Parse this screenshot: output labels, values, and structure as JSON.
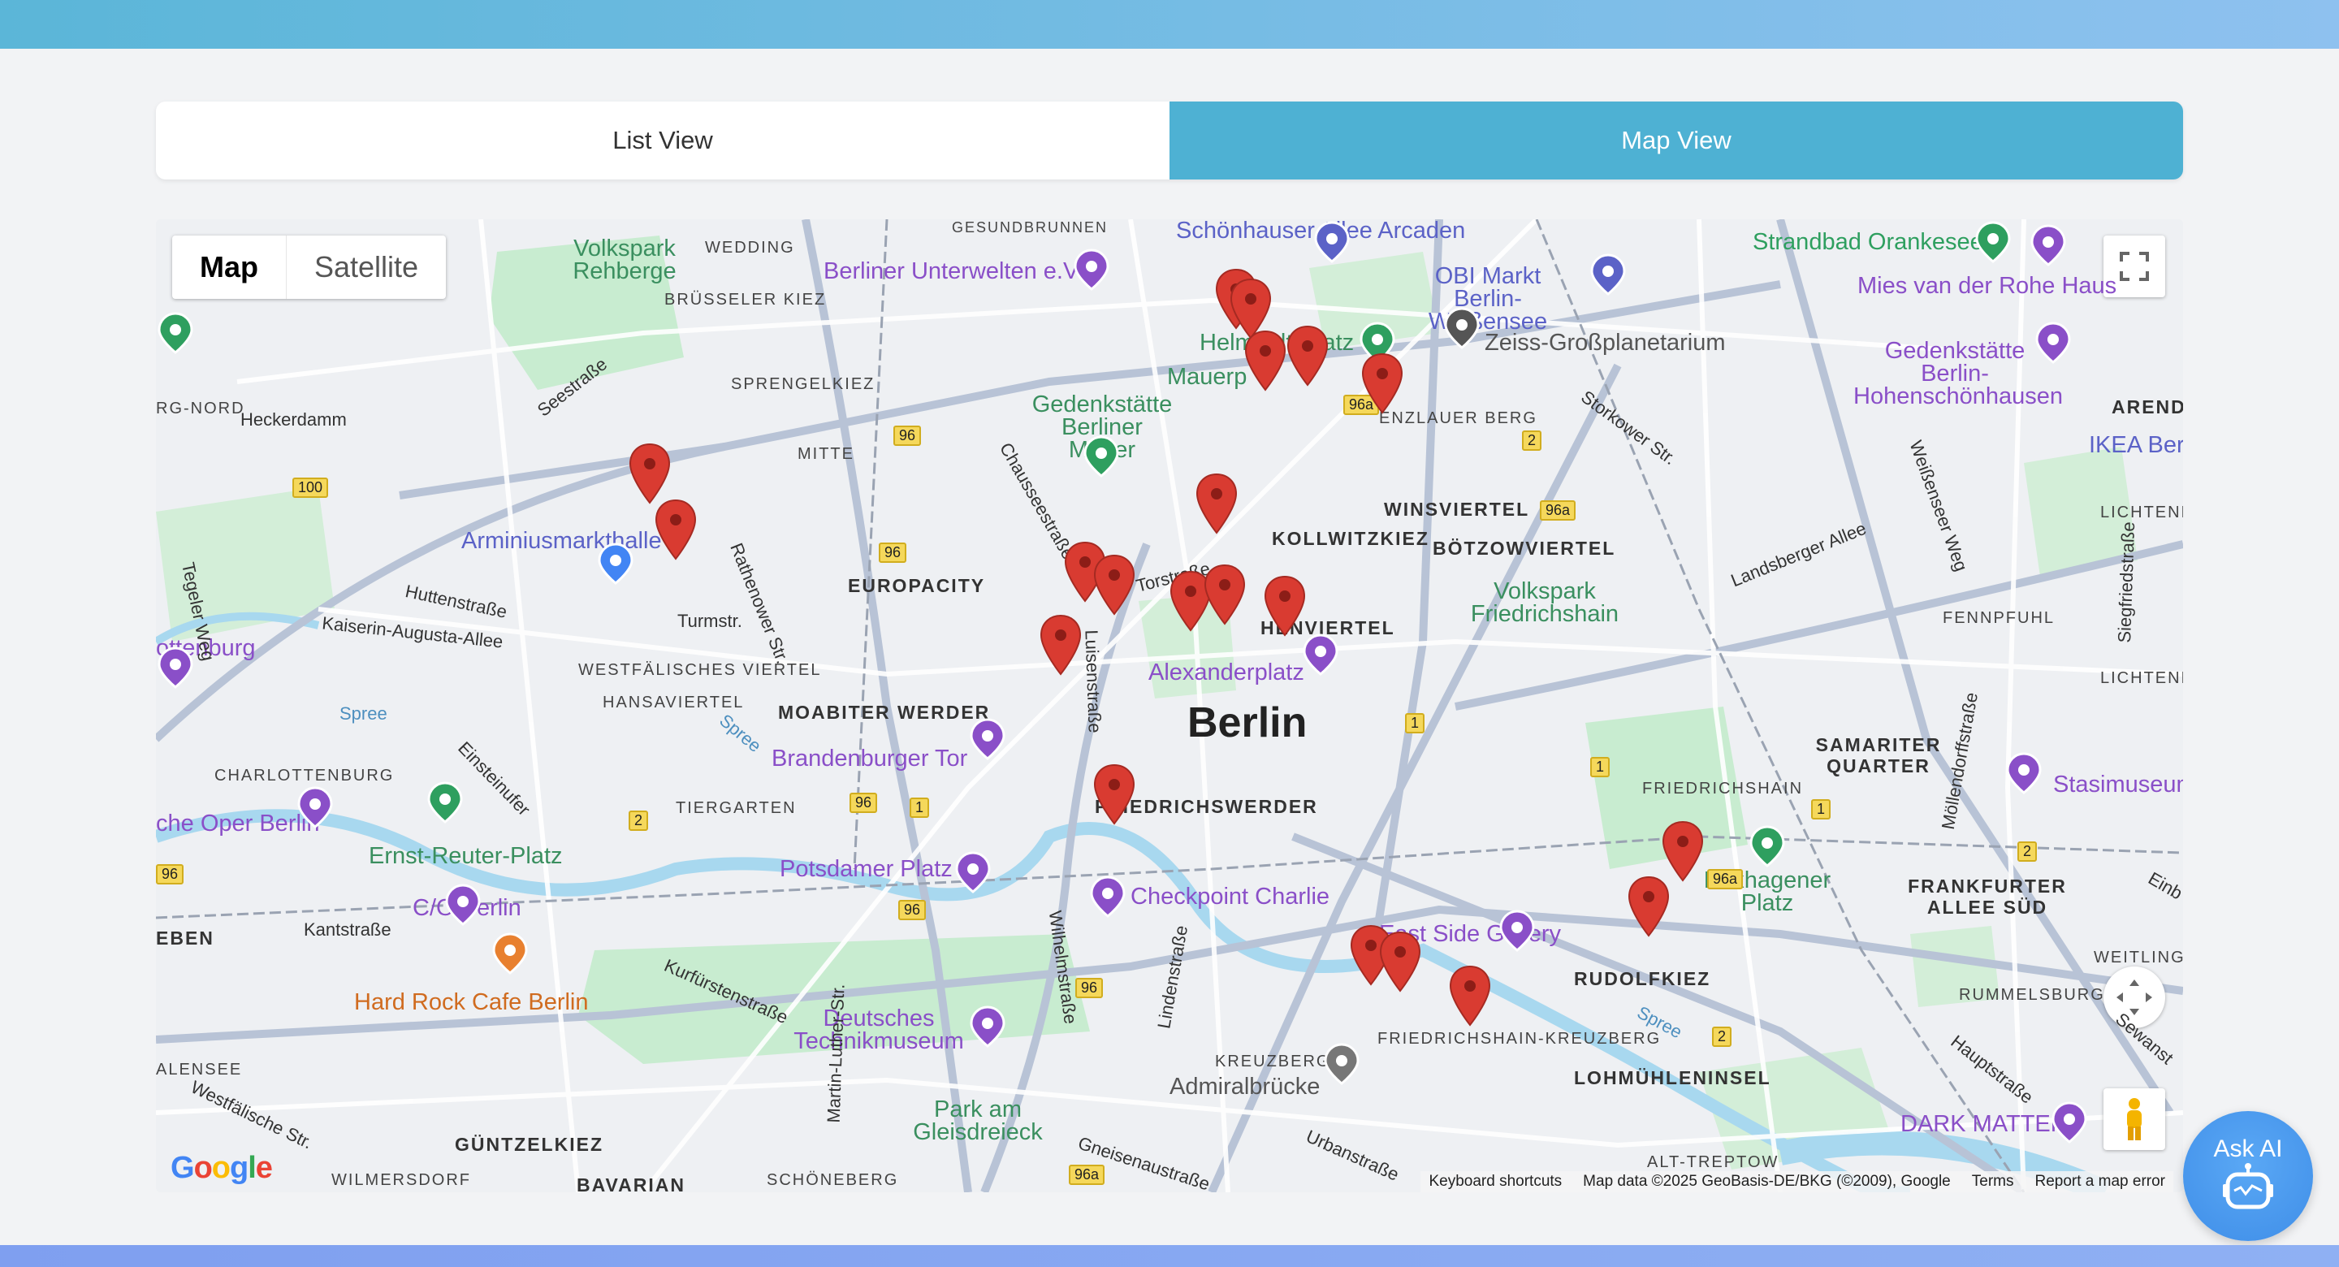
{
  "tabs": {
    "list_label": "List View",
    "map_label": "Map View",
    "active": "Map View"
  },
  "map": {
    "type_control": {
      "map_label": "Map",
      "satellite_label": "Satellite",
      "selected": "Map"
    },
    "center_label": "Berlin",
    "google_logo": "Google",
    "attribution": {
      "shortcuts": "Keyboard shortcuts",
      "data": "Map data ©2025 GeoBasis-DE/BKG (©2009), Google",
      "terms": "Terms",
      "report": "Report a map error"
    },
    "places": {
      "schonhauser": "Schönhauser Allee Arcaden",
      "strandbad": "Strandbad Orankesee",
      "volkspark_rehberge": "Volkspark Rehberge",
      "berliner_unterwelten": "Berliner Unterwelten e.V",
      "mies": "Mies van der Rohe Haus",
      "obi": "OBI Markt Berlin-Weißensee",
      "helmholtz": "Helmholtzplatz",
      "zeiss": "Zeiss-Großplanetarium",
      "hohenschoenhausen": "Gedenkstätte Berlin-Hohenschönhausen",
      "mauerpark": "Mauerp",
      "gedenk_mauer": "Gedenkstätte Berliner Mauer",
      "arminius": "Arminiusmarkthalle",
      "ikea": "IKEA Berl",
      "volkspark_fhain": "Volkspark Friedrichshain",
      "charlottenburg": "ottenburg",
      "alexanderplatz": "Alexanderplatz",
      "brandenburger": "Brandenburger Tor",
      "stasi": "Stasimuseum",
      "deutsche_oper": "che Oper Berlin",
      "ernst_reuter": "Ernst-Reuter-Platz",
      "potsdamer": "Potsdamer Platz",
      "boxhagener": "Boxhagener Platz",
      "checkpoint": "Checkpoint Charlie",
      "co_berlin": "C/O Berlin",
      "east_side": "East Side Gallery",
      "hard_rock": "Hard Rock Cafe Berlin",
      "technikmuseum": "Deutsches Technikmuseum",
      "admiralbruecke": "Admiralbrücke",
      "park_gleisdreieck": "Park am Gleisdreieck",
      "dark_matter": "DARK MATTER"
    },
    "districts": {
      "wedding": "WEDDING",
      "bruesseler": "BRÜSSELER KIEZ",
      "sprengel": "SPRENGELKIEZ",
      "mitte": "MITTE",
      "europacity": "EUROPACITY",
      "kollwitz": "KOLLWITZKIEZ",
      "winsviertel": "WINSVIERTEL",
      "boetzow": "BÖTZOWVIERTEL",
      "prenzlauer": "ENZLAUER BERG",
      "westfaelisches": "WESTFÄLISCHES VIERTEL",
      "hansaviertel": "HANSAVIERTEL",
      "moabiter": "MOABITER WERDER",
      "charlottenburg_d": "CHARLOTTENBURG",
      "tiergarten": "TIERGARTEN",
      "friedrichswerder": "FRIEDRICHSWERDER",
      "samariter": "SAMARITER QUARTER",
      "friedrichshain": "FRIEDRICHSHAIN",
      "frankfurter": "FRANKFURTER ALLEE SÜD",
      "rudolfkiez": "RUDOLFKIEZ",
      "rummelsburg": "RUMMELSBURG",
      "weitlingk": "WEITLINGK",
      "fennpfuhl": "FENNPFUHL",
      "lichtenberg": "LICHTENBERG",
      "lichtenberg2": "LICHTENBER",
      "kreuzberg": "KREUZBERG",
      "fhain_kreuzberg": "FRIEDRICHSHAIN-KREUZBERG",
      "lohmuehlen": "LOHMÜHLENINSEL",
      "alt_treptow": "ALT-TREPTOW",
      "guentzelkiez": "GÜNTZELKIEZ",
      "wilmersdorf": "WILMERSDORF",
      "bavarian": "BAVARIAN",
      "schoeneberg": "SCHÖNEBERG",
      "halensee": "ALENSEE",
      "eben": "EBEN",
      "rg_nord": "RG-NORD",
      "arend": "AREND",
      "gesundbrunnen": "GESUNDBRUNNEN",
      "jhen_viertel": "HENVIERTEL"
    },
    "streets": {
      "heckerdamm": "Heckerdamm",
      "seestrasse": "Seestraße",
      "huttenstrasse": "Huttenstraße",
      "kaiserin": "Kaiserin-Augusta-Allee",
      "turmstr": "Turmstr.",
      "rathenower": "Rathenower Str.",
      "chaussee": "Chausseestraße",
      "torstrasse": "Torstraße",
      "luisen": "Luisenstraße",
      "tegeler": "Tegeler Weg",
      "spree": "Spree",
      "spree2": "Spree",
      "spree3": "Spree",
      "einsteinufer": "Einsteinufer",
      "kantstrasse": "Kantstraße",
      "kurfuersten": "Kurfürstenstraße",
      "wilhelm": "Wilhelmstraße",
      "linden": "Lindenstraße",
      "martin_luther": "Martin-Luther-Str.",
      "westfaelische": "Westfälische Str.",
      "gneisenau": "Gneisenaustraße",
      "urbanstr": "Urbanstraße",
      "storkower": "Storkower Str.",
      "landsberger": "Landsberger Allee",
      "weissenseer": "Weißenseer Weg",
      "siegfried": "Siegfriedstraße",
      "moellendorff": "Möllendorffstraße",
      "haupt": "Hauptstraße",
      "sewanst": "Sewanst",
      "einb": "Einb"
    },
    "route_shields": [
      "96",
      "96",
      "100",
      "96a",
      "96a",
      "2",
      "96a",
      "1",
      "1",
      "1",
      "2",
      "2",
      "96",
      "1",
      "96",
      "96",
      "96a",
      "2"
    ],
    "marker_count": 22,
    "colors": {
      "marker": "#d93b31",
      "poi_purple": "#8a4fc8",
      "poi_green": "#2e9f5f",
      "park": "#c8ecd0",
      "water": "#a8d8ef"
    }
  },
  "ask_ai": {
    "label": "Ask AI",
    "icon": "robot-icon"
  }
}
